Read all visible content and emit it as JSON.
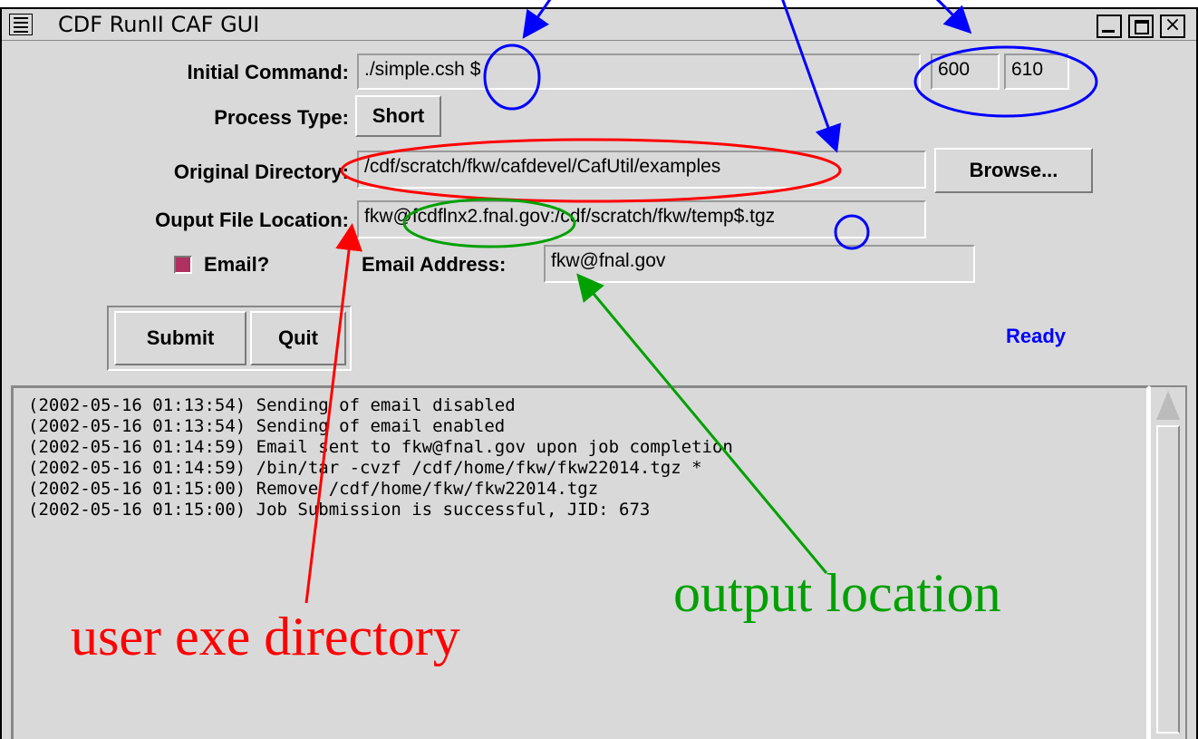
{
  "window": {
    "title": "CDF RunII CAF GUI"
  },
  "form": {
    "initial_command": {
      "label": "Initial Command:",
      "value": "./simple.csh $",
      "range_start": "600",
      "range_end": "610"
    },
    "process_type": {
      "label": "Process Type:",
      "value": "Short"
    },
    "original_directory": {
      "label": "Original Directory:",
      "value": "/cdf/scratch/fkw/cafdevel/CafUtil/examples",
      "browse_label": "Browse..."
    },
    "output_location": {
      "label": "Ouput File Location:",
      "value": "fkw@fcdflnx2.fnal.gov:/cdf/scratch/fkw/temp$.tgz"
    },
    "email": {
      "checkbox_label": "Email?",
      "checked": true,
      "address_label": "Email Address:",
      "address_value": "fkw@fnal.gov"
    },
    "submit_label": "Submit",
    "quit_label": "Quit",
    "status": "Ready"
  },
  "log": [
    "(2002-05-16 01:13:54) Sending of email disabled",
    "(2002-05-16 01:13:54) Sending of email enabled",
    "(2002-05-16 01:14:59) Email sent to fkw@fnal.gov upon job completion",
    "(2002-05-16 01:14:59) /bin/tar -cvzf /cdf/home/fkw/fkw22014.tgz *",
    "(2002-05-16 01:15:00) Remove /cdf/home/fkw/fkw22014.tgz",
    "(2002-05-16 01:15:00) Job Submission is successful, JID: 673"
  ],
  "annotations": {
    "user_exe_directory": "user exe directory",
    "output_location": "output location",
    "colors": {
      "blue": "#0000ff",
      "red": "#ff0000",
      "green": "#00a000"
    }
  }
}
